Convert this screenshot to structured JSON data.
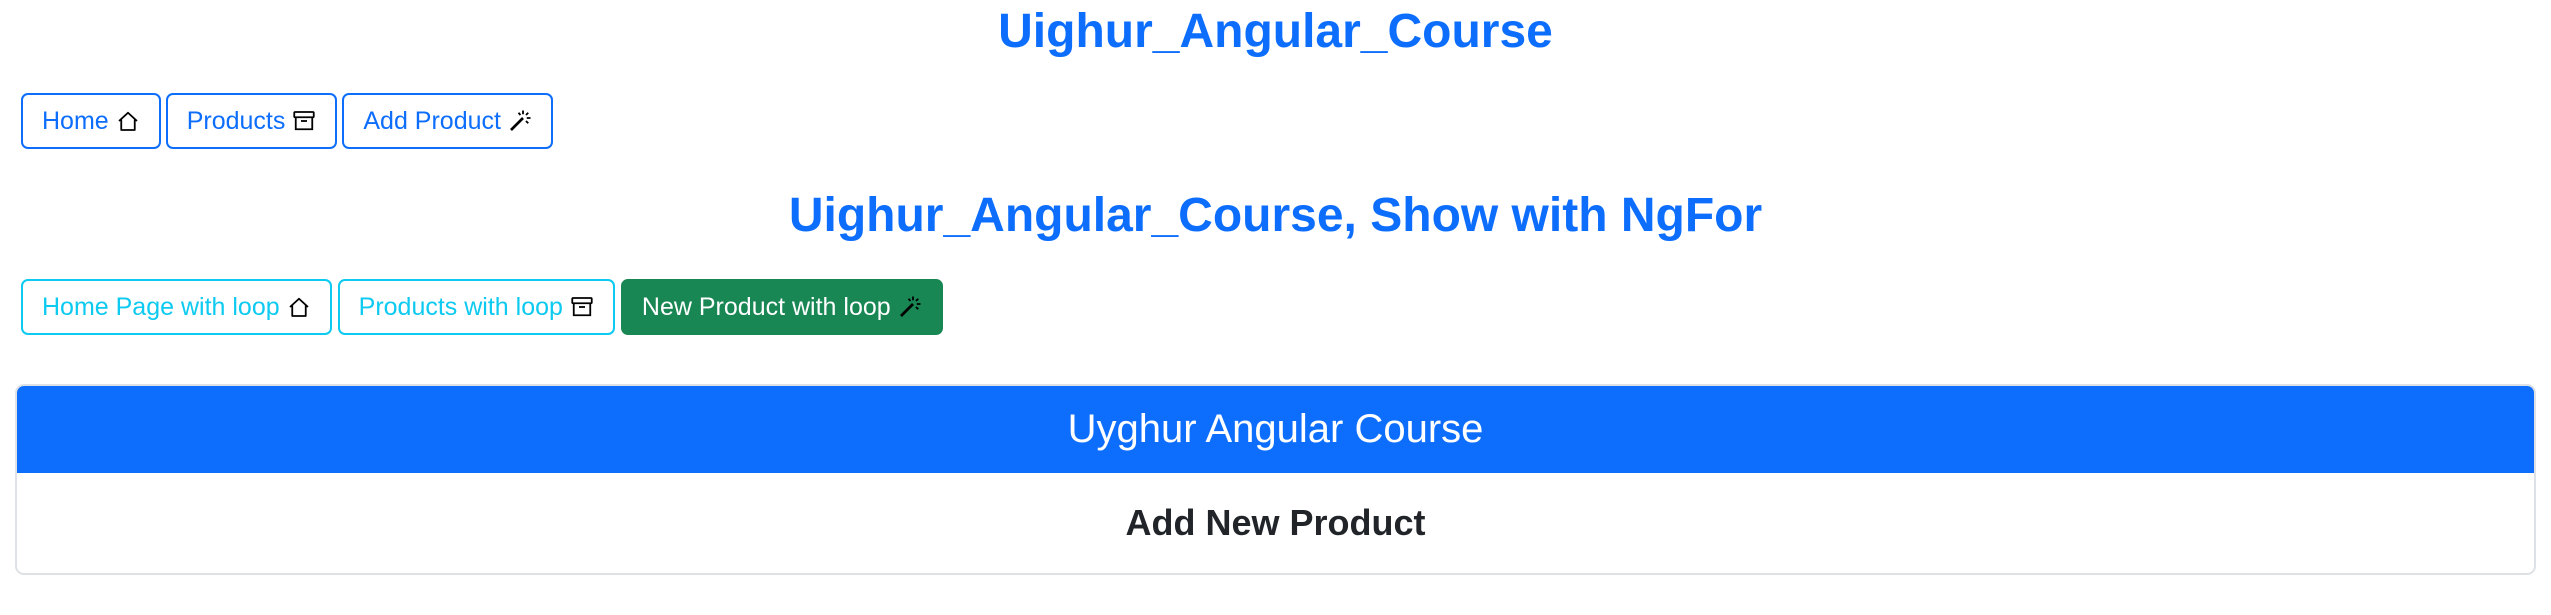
{
  "colors": {
    "primary": "#0d6efd",
    "info": "#0dcaf0",
    "success": "#198754",
    "border": "#dee2e6",
    "text": "#212529"
  },
  "header": {
    "title": "Uighur_Angular_Course",
    "nav": [
      {
        "label": "Home",
        "icon": "house-icon"
      },
      {
        "label": "Products",
        "icon": "archive-icon"
      },
      {
        "label": "Add Product",
        "icon": "magic-wand-icon"
      }
    ]
  },
  "ngfor_section": {
    "title": "Uighur_Angular_Course, Show with NgFor",
    "nav": [
      {
        "label": "Home Page with loop",
        "icon": "house-icon"
      },
      {
        "label": "Products with loop",
        "icon": "archive-icon"
      },
      {
        "label": "New Product with loop",
        "icon": "magic-wand-icon",
        "active": true
      }
    ]
  },
  "card": {
    "header": "Uyghur Angular Course",
    "body": "Add New Product"
  }
}
